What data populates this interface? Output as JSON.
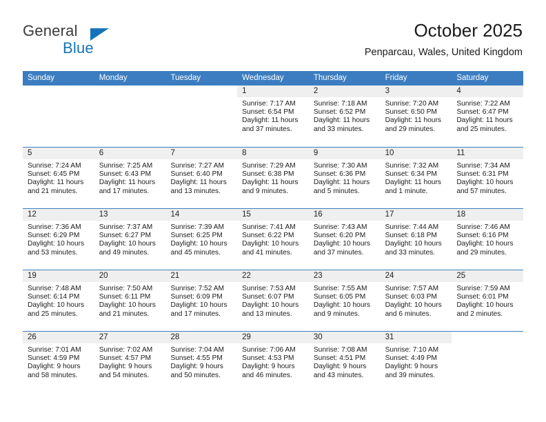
{
  "brand": {
    "name_part1": "General",
    "name_part2": "Blue",
    "accent_color": "#1574b8"
  },
  "header": {
    "title": "October 2025",
    "subtitle": "Penparcau, Wales, United Kingdom"
  },
  "theme": {
    "header_blue": "#3b7dc0",
    "daynum_band": "#efefef"
  },
  "weekdays": [
    "Sunday",
    "Monday",
    "Tuesday",
    "Wednesday",
    "Thursday",
    "Friday",
    "Saturday"
  ],
  "weeks": [
    [
      {
        "day": ""
      },
      {
        "day": ""
      },
      {
        "day": ""
      },
      {
        "day": "1",
        "sunrise": "Sunrise: 7:17 AM",
        "sunset": "Sunset: 6:54 PM",
        "daylight_1": "Daylight: 11 hours",
        "daylight_2": "and 37 minutes."
      },
      {
        "day": "2",
        "sunrise": "Sunrise: 7:18 AM",
        "sunset": "Sunset: 6:52 PM",
        "daylight_1": "Daylight: 11 hours",
        "daylight_2": "and 33 minutes."
      },
      {
        "day": "3",
        "sunrise": "Sunrise: 7:20 AM",
        "sunset": "Sunset: 6:50 PM",
        "daylight_1": "Daylight: 11 hours",
        "daylight_2": "and 29 minutes."
      },
      {
        "day": "4",
        "sunrise": "Sunrise: 7:22 AM",
        "sunset": "Sunset: 6:47 PM",
        "daylight_1": "Daylight: 11 hours",
        "daylight_2": "and 25 minutes."
      }
    ],
    [
      {
        "day": "5",
        "sunrise": "Sunrise: 7:24 AM",
        "sunset": "Sunset: 6:45 PM",
        "daylight_1": "Daylight: 11 hours",
        "daylight_2": "and 21 minutes."
      },
      {
        "day": "6",
        "sunrise": "Sunrise: 7:25 AM",
        "sunset": "Sunset: 6:43 PM",
        "daylight_1": "Daylight: 11 hours",
        "daylight_2": "and 17 minutes."
      },
      {
        "day": "7",
        "sunrise": "Sunrise: 7:27 AM",
        "sunset": "Sunset: 6:40 PM",
        "daylight_1": "Daylight: 11 hours",
        "daylight_2": "and 13 minutes."
      },
      {
        "day": "8",
        "sunrise": "Sunrise: 7:29 AM",
        "sunset": "Sunset: 6:38 PM",
        "daylight_1": "Daylight: 11 hours",
        "daylight_2": "and 9 minutes."
      },
      {
        "day": "9",
        "sunrise": "Sunrise: 7:30 AM",
        "sunset": "Sunset: 6:36 PM",
        "daylight_1": "Daylight: 11 hours",
        "daylight_2": "and 5 minutes."
      },
      {
        "day": "10",
        "sunrise": "Sunrise: 7:32 AM",
        "sunset": "Sunset: 6:34 PM",
        "daylight_1": "Daylight: 11 hours",
        "daylight_2": "and 1 minute."
      },
      {
        "day": "11",
        "sunrise": "Sunrise: 7:34 AM",
        "sunset": "Sunset: 6:31 PM",
        "daylight_1": "Daylight: 10 hours",
        "daylight_2": "and 57 minutes."
      }
    ],
    [
      {
        "day": "12",
        "sunrise": "Sunrise: 7:36 AM",
        "sunset": "Sunset: 6:29 PM",
        "daylight_1": "Daylight: 10 hours",
        "daylight_2": "and 53 minutes."
      },
      {
        "day": "13",
        "sunrise": "Sunrise: 7:37 AM",
        "sunset": "Sunset: 6:27 PM",
        "daylight_1": "Daylight: 10 hours",
        "daylight_2": "and 49 minutes."
      },
      {
        "day": "14",
        "sunrise": "Sunrise: 7:39 AM",
        "sunset": "Sunset: 6:25 PM",
        "daylight_1": "Daylight: 10 hours",
        "daylight_2": "and 45 minutes."
      },
      {
        "day": "15",
        "sunrise": "Sunrise: 7:41 AM",
        "sunset": "Sunset: 6:22 PM",
        "daylight_1": "Daylight: 10 hours",
        "daylight_2": "and 41 minutes."
      },
      {
        "day": "16",
        "sunrise": "Sunrise: 7:43 AM",
        "sunset": "Sunset: 6:20 PM",
        "daylight_1": "Daylight: 10 hours",
        "daylight_2": "and 37 minutes."
      },
      {
        "day": "17",
        "sunrise": "Sunrise: 7:44 AM",
        "sunset": "Sunset: 6:18 PM",
        "daylight_1": "Daylight: 10 hours",
        "daylight_2": "and 33 minutes."
      },
      {
        "day": "18",
        "sunrise": "Sunrise: 7:46 AM",
        "sunset": "Sunset: 6:16 PM",
        "daylight_1": "Daylight: 10 hours",
        "daylight_2": "and 29 minutes."
      }
    ],
    [
      {
        "day": "19",
        "sunrise": "Sunrise: 7:48 AM",
        "sunset": "Sunset: 6:14 PM",
        "daylight_1": "Daylight: 10 hours",
        "daylight_2": "and 25 minutes."
      },
      {
        "day": "20",
        "sunrise": "Sunrise: 7:50 AM",
        "sunset": "Sunset: 6:11 PM",
        "daylight_1": "Daylight: 10 hours",
        "daylight_2": "and 21 minutes."
      },
      {
        "day": "21",
        "sunrise": "Sunrise: 7:52 AM",
        "sunset": "Sunset: 6:09 PM",
        "daylight_1": "Daylight: 10 hours",
        "daylight_2": "and 17 minutes."
      },
      {
        "day": "22",
        "sunrise": "Sunrise: 7:53 AM",
        "sunset": "Sunset: 6:07 PM",
        "daylight_1": "Daylight: 10 hours",
        "daylight_2": "and 13 minutes."
      },
      {
        "day": "23",
        "sunrise": "Sunrise: 7:55 AM",
        "sunset": "Sunset: 6:05 PM",
        "daylight_1": "Daylight: 10 hours",
        "daylight_2": "and 9 minutes."
      },
      {
        "day": "24",
        "sunrise": "Sunrise: 7:57 AM",
        "sunset": "Sunset: 6:03 PM",
        "daylight_1": "Daylight: 10 hours",
        "daylight_2": "and 6 minutes."
      },
      {
        "day": "25",
        "sunrise": "Sunrise: 7:59 AM",
        "sunset": "Sunset: 6:01 PM",
        "daylight_1": "Daylight: 10 hours",
        "daylight_2": "and 2 minutes."
      }
    ],
    [
      {
        "day": "26",
        "sunrise": "Sunrise: 7:01 AM",
        "sunset": "Sunset: 4:59 PM",
        "daylight_1": "Daylight: 9 hours",
        "daylight_2": "and 58 minutes."
      },
      {
        "day": "27",
        "sunrise": "Sunrise: 7:02 AM",
        "sunset": "Sunset: 4:57 PM",
        "daylight_1": "Daylight: 9 hours",
        "daylight_2": "and 54 minutes."
      },
      {
        "day": "28",
        "sunrise": "Sunrise: 7:04 AM",
        "sunset": "Sunset: 4:55 PM",
        "daylight_1": "Daylight: 9 hours",
        "daylight_2": "and 50 minutes."
      },
      {
        "day": "29",
        "sunrise": "Sunrise: 7:06 AM",
        "sunset": "Sunset: 4:53 PM",
        "daylight_1": "Daylight: 9 hours",
        "daylight_2": "and 46 minutes."
      },
      {
        "day": "30",
        "sunrise": "Sunrise: 7:08 AM",
        "sunset": "Sunset: 4:51 PM",
        "daylight_1": "Daylight: 9 hours",
        "daylight_2": "and 43 minutes."
      },
      {
        "day": "31",
        "sunrise": "Sunrise: 7:10 AM",
        "sunset": "Sunset: 4:49 PM",
        "daylight_1": "Daylight: 9 hours",
        "daylight_2": "and 39 minutes."
      },
      {
        "day": ""
      }
    ]
  ]
}
